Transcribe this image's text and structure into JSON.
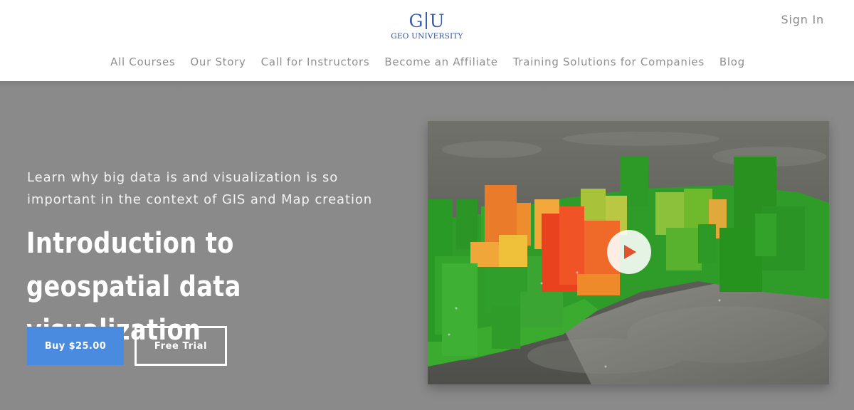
{
  "brand": {
    "mark_left": "G",
    "mark_right": "U",
    "name": "GEO UNIVERSITY",
    "color": "#3d5fa8"
  },
  "header": {
    "sign_in": "Sign In"
  },
  "nav": [
    "All Courses",
    "Our Story",
    "Call for Instructors",
    "Become an Affiliate",
    "Training Solutions for Companies",
    "Blog"
  ],
  "hero": {
    "subtitle": "Learn why big data is and visualization is so important in the context of GIS and Map creation",
    "title": "Introduction to geospatial data visualization",
    "buy_label": "Buy $25.00",
    "trial_label": "Free Trial",
    "background_color": "#8a8a8a",
    "buy_color": "#4a8be0"
  },
  "video": {
    "play_icon": "play-icon",
    "play_color": "#e0522b"
  }
}
